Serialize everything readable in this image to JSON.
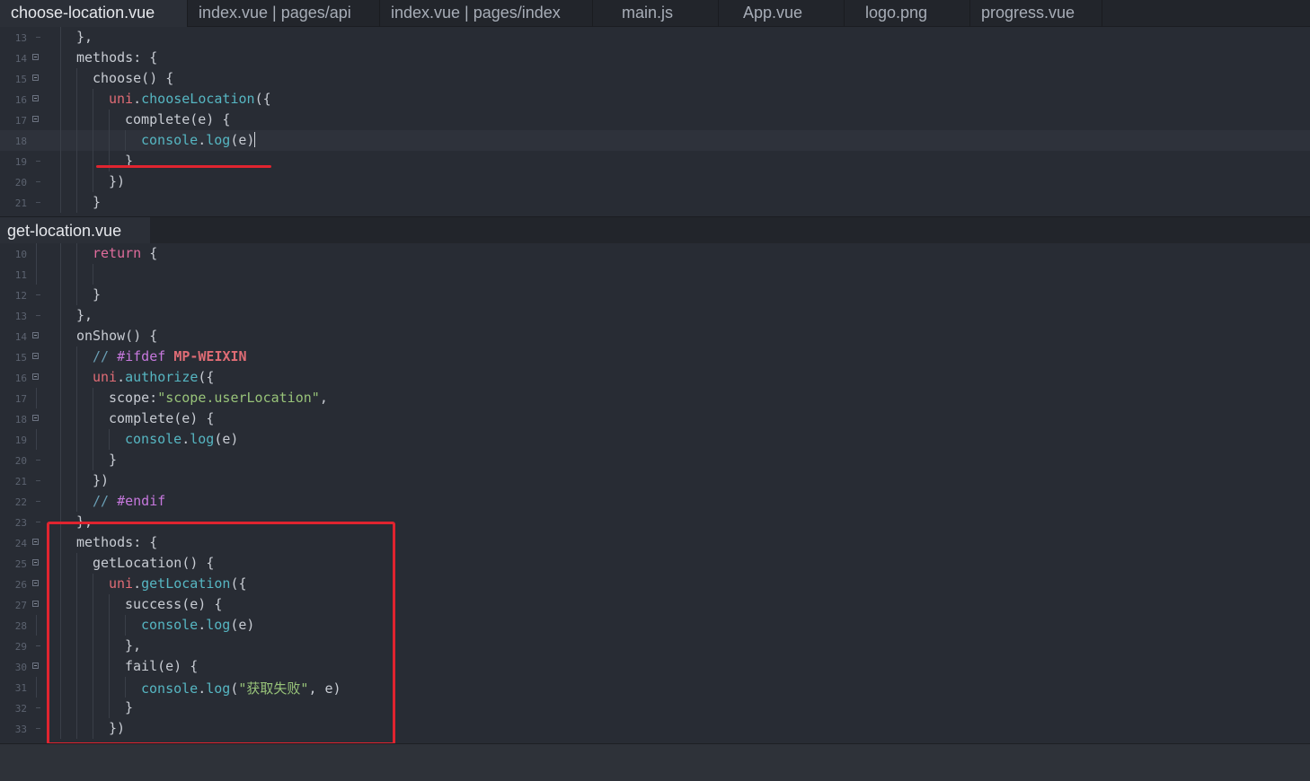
{
  "tabs": [
    {
      "label": "choose-location.vue",
      "active": true
    },
    {
      "label": "index.vue | pages/api",
      "active": false
    },
    {
      "label": "index.vue | pages/index",
      "active": false
    },
    {
      "label": "main.js",
      "active": false
    },
    {
      "label": "App.vue",
      "active": false
    },
    {
      "label": "logo.png",
      "active": false
    },
    {
      "label": "progress.vue",
      "active": false
    }
  ],
  "top_pane": {
    "lines": [
      {
        "num": "13",
        "t1": "},"
      },
      {
        "num": "14",
        "t1": "methods: {"
      },
      {
        "num": "15",
        "t1": "choose() {"
      },
      {
        "num": "16",
        "obj": "uni",
        "dot": ".",
        "call": "chooseLocation",
        "rest": "({"
      },
      {
        "num": "17",
        "t1": "complete(e) {"
      },
      {
        "num": "18",
        "obj": "console",
        "dot": ".",
        "call": "log",
        "rest": "(e)"
      },
      {
        "num": "19",
        "t1": "}"
      },
      {
        "num": "20",
        "t1": "})"
      },
      {
        "num": "21",
        "t1": "}"
      }
    ]
  },
  "split_tab": {
    "label": "get-location.vue"
  },
  "bottom_pane": {
    "lines": [
      {
        "num": "10",
        "kw": "return",
        "rest": " {"
      },
      {
        "num": "11",
        "t1": ""
      },
      {
        "num": "12",
        "t1": "}"
      },
      {
        "num": "13",
        "t1": "},"
      },
      {
        "num": "14",
        "t1": "onShow() {"
      },
      {
        "num": "15",
        "cmt": "// ",
        "pre": "#ifdef",
        "mac": "MP-WEIXIN"
      },
      {
        "num": "16",
        "obj": "uni",
        "dot": ".",
        "call": "authorize",
        "rest": "({"
      },
      {
        "num": "17",
        "key": "scope:",
        "str": "\"scope.userLocation\"",
        "rest": ","
      },
      {
        "num": "18",
        "t1": "complete(e) {"
      },
      {
        "num": "19",
        "obj": "console",
        "dot": ".",
        "call": "log",
        "rest": "(e)"
      },
      {
        "num": "20",
        "t1": "}"
      },
      {
        "num": "21",
        "t1": "})"
      },
      {
        "num": "22",
        "cmt": "// ",
        "pre": "#endif"
      },
      {
        "num": "23",
        "t1": "},"
      },
      {
        "num": "24",
        "t1": "methods: {"
      },
      {
        "num": "25",
        "t1": "getLocation() {"
      },
      {
        "num": "26",
        "obj": "uni",
        "dot": ".",
        "call": "getLocation",
        "rest": "({"
      },
      {
        "num": "27",
        "t1": "success(e) {"
      },
      {
        "num": "28",
        "obj": "console",
        "dot": ".",
        "call": "log",
        "rest": "(e)"
      },
      {
        "num": "29",
        "t1": "},"
      },
      {
        "num": "30",
        "t1": "fail(e) {"
      },
      {
        "num": "31",
        "obj": "console",
        "dot": ".",
        "call": "log",
        "open": "(",
        "str": "\"获取失败\"",
        "rest": ", e)"
      },
      {
        "num": "32",
        "t1": "}"
      },
      {
        "num": "33",
        "t1": "})"
      }
    ]
  },
  "colors": {
    "annotation": "#e0242f",
    "background": "#282c34",
    "keyword": "#e06c9c",
    "function": "#56b6c2",
    "string": "#98c379"
  }
}
